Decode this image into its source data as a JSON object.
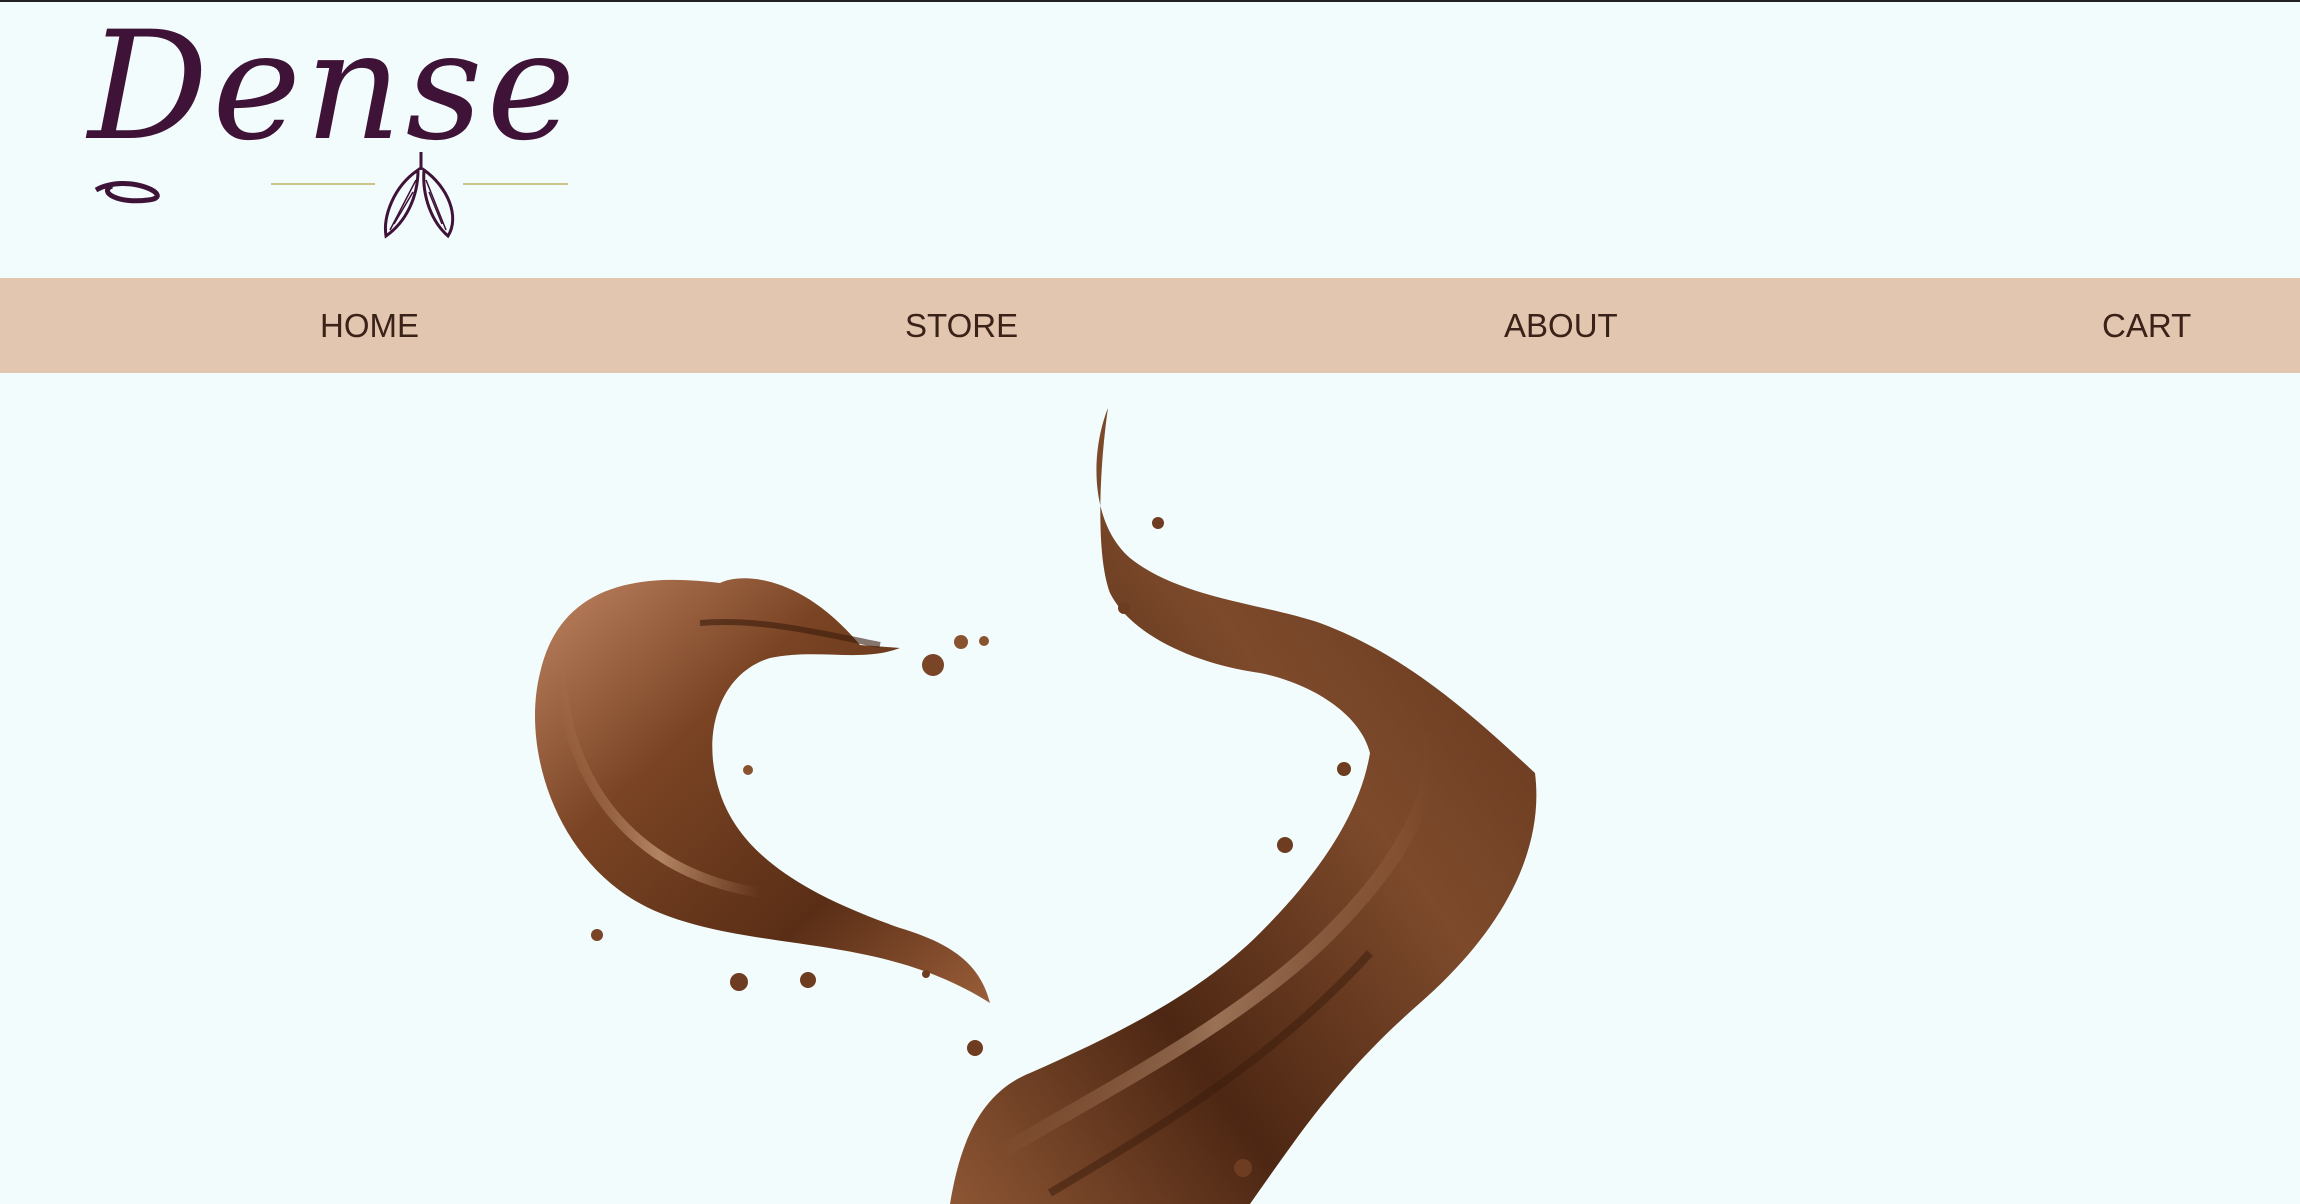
{
  "brand": {
    "logo_text": "Dense",
    "logo_color": "#3f1238",
    "logo_accent_color": "#c9c48e"
  },
  "nav": {
    "background": "#e2c6af",
    "items": [
      {
        "label": "HOME"
      },
      {
        "label": "STORE"
      },
      {
        "label": "ABOUT"
      },
      {
        "label": "CART"
      }
    ]
  },
  "hero": {
    "image": "chocolate-splash-heart",
    "chocolate_color": "#6b3a1e"
  },
  "page": {
    "background": "#f2fcfc"
  }
}
